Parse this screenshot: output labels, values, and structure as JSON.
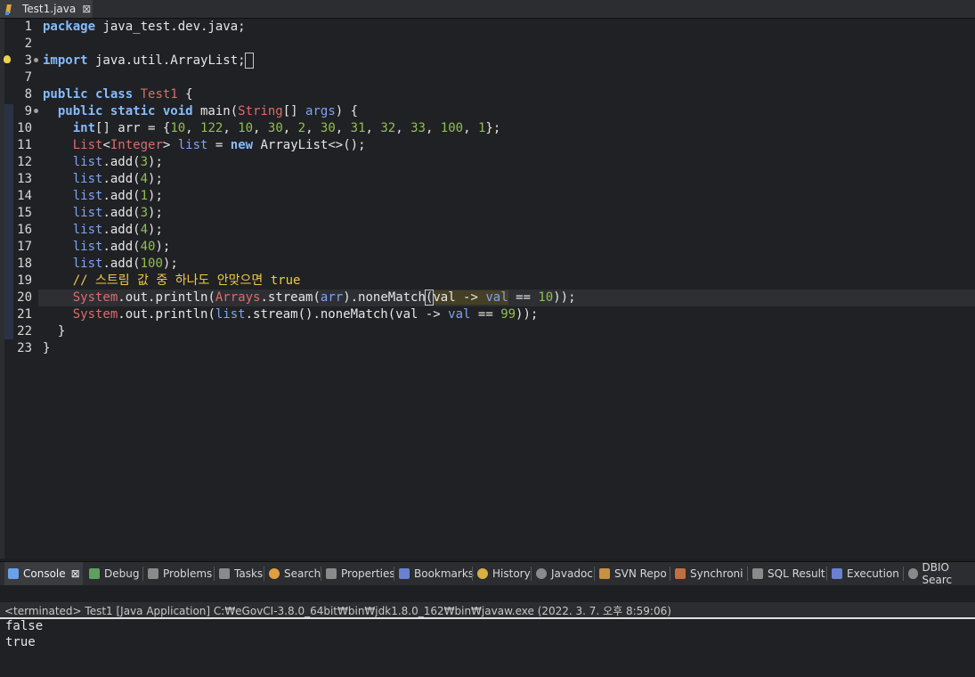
{
  "editor_tab": {
    "label": "Test1.java",
    "close": "⊠"
  },
  "lines": [
    {
      "num": "1"
    },
    {
      "num": "2"
    },
    {
      "num": "3"
    },
    {
      "num": "7"
    },
    {
      "num": "8"
    },
    {
      "num": "9"
    },
    {
      "num": "10"
    },
    {
      "num": "11"
    },
    {
      "num": "12"
    },
    {
      "num": "13"
    },
    {
      "num": "14"
    },
    {
      "num": "15"
    },
    {
      "num": "16"
    },
    {
      "num": "17"
    },
    {
      "num": "18"
    },
    {
      "num": "19"
    },
    {
      "num": "20"
    },
    {
      "num": "21"
    },
    {
      "num": "22"
    },
    {
      "num": "23"
    }
  ],
  "code": {
    "l1_kw": "package",
    "l1_rest": " java_test.dev.java;",
    "l3_kw": "import",
    "l3_rest": " java.util.ArrayList;",
    "l8_kw": "public class",
    "l8_name": "Test1",
    "l8_rest": " {",
    "l9_kw": "public static void",
    "l9_name": " main(",
    "l9_type": "String",
    "l9_mid": "[] ",
    "l9_args": "args",
    "l9_end": ") {",
    "l10_kw": "int",
    "l10_a": "[] arr = {",
    "l10_nums": [
      "10",
      "122",
      "10",
      "30",
      "2",
      "30",
      "31",
      "32",
      "33",
      "100",
      "1"
    ],
    "l10_end": "};",
    "l11_type": "List",
    "l11_a": "<",
    "l11_gen": "Integer",
    "l11_b": "> ",
    "l11_var": "list",
    "l11_c": " = ",
    "l11_kw": "new",
    "l11_d": " ArrayList<>();",
    "add_lines": [
      {
        "var": "list",
        "call": ".add(",
        "arg": "3",
        "end": ");"
      },
      {
        "var": "list",
        "call": ".add(",
        "arg": "4",
        "end": ");"
      },
      {
        "var": "list",
        "call": ".add(",
        "arg": "1",
        "end": ");"
      },
      {
        "var": "list",
        "call": ".add(",
        "arg": "3",
        "end": ");"
      },
      {
        "var": "list",
        "call": ".add(",
        "arg": "4",
        "end": ");"
      },
      {
        "var": "list",
        "call": ".add(",
        "arg": "40",
        "end": ");"
      },
      {
        "var": "list",
        "call": ".add(",
        "arg": "100",
        "end": ");"
      }
    ],
    "l19_comment": "// 스트림 값 중 하나도 안맞으면 true",
    "l20_sys": "System",
    "l20_a": ".out.println(",
    "l20_arrays": "Arrays",
    "l20_b": ".stream(",
    "l20_arr": "arr",
    "l20_c": ").noneMatch",
    "l20_d": "(",
    "l20_e": "val -> ",
    "l20_val": "val",
    "l20_f": " == ",
    "l20_num": "10",
    "l20_g": "));",
    "l21_sys": "System",
    "l21_a": ".out.println(",
    "l21_list": "list",
    "l21_b": ".stream().noneMatch(val -> ",
    "l21_val": "val",
    "l21_c": " == ",
    "l21_num": "99",
    "l21_d": "));",
    "l22": "  }",
    "l23": "}"
  },
  "panel_tabs": [
    {
      "label": "Console",
      "color": "#6aa0e8"
    },
    {
      "label": "Debug",
      "color": "#5fa05f"
    },
    {
      "label": "Problems",
      "color": "#8a8a8a"
    },
    {
      "label": "Tasks",
      "color": "#8a8a8a"
    },
    {
      "label": "Search",
      "color": "#e0a040"
    },
    {
      "label": "Properties",
      "color": "#8a8a8a"
    },
    {
      "label": "Bookmarks",
      "color": "#6a80d0"
    },
    {
      "label": "History",
      "color": "#d8b040"
    },
    {
      "label": "Javadoc",
      "color": "#8a8a8a"
    },
    {
      "label": "SVN Repo",
      "color": "#c89040"
    },
    {
      "label": "Synchroni",
      "color": "#c07040"
    },
    {
      "label": "SQL Result",
      "color": "#8a8a8a"
    },
    {
      "label": "Execution",
      "color": "#6a80d0"
    },
    {
      "label": "DBIO Searc",
      "color": "#8a8a8a"
    }
  ],
  "console": {
    "status": "<terminated> Test1 [Java Application] C:₩eGovCI-3.8.0_64bit₩bin₩jdk1.8.0_162₩bin₩javaw.exe (2022. 3. 7. 오후 8:59:06)",
    "output": [
      "false",
      "true"
    ]
  }
}
